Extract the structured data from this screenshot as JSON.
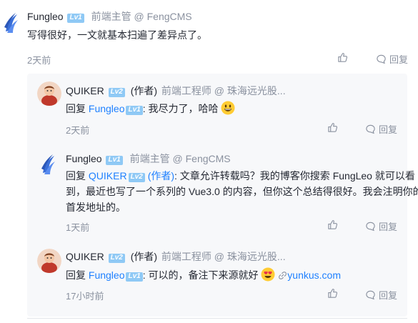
{
  "root_comment": {
    "user": "Fungleo",
    "level": "Lv1",
    "title": "前端主管 @ FengCMS",
    "content": "写得很好，一文就基本扫遍了差异点了。",
    "time": "2天前",
    "reply_label": "回复"
  },
  "replies": [
    {
      "user": "QUIKER",
      "level": "Lv2",
      "author_tag": "(作者)",
      "title": "前端工程师 @ 珠海远光股...",
      "reply_prefix": "回复",
      "reply_to": "Fungleo",
      "reply_to_level": "Lv1",
      "content": ": 我尽力了，哈哈",
      "time": "2天前",
      "reply_label": "回复"
    },
    {
      "user": "Fungleo",
      "level": "Lv1",
      "title": "前端主管 @ FengCMS",
      "reply_prefix": "回复",
      "reply_to": "QUIKER",
      "reply_to_level": "Lv2",
      "reply_to_tag": "(作者)",
      "content_line1": ": 文章允许转载吗？我的博客你搜索 FungLeo 就可以看",
      "content_line2": "到，最近也写了一个系列的 Vue3.0 的内容，但你这个总结得很好。我会注明你的",
      "content_line3": "首发地址的。",
      "time": "1天前",
      "reply_label": "回复"
    },
    {
      "user": "QUIKER",
      "level": "Lv2",
      "author_tag": "(作者)",
      "title": "前端工程师 @ 珠海远光股...",
      "reply_prefix": "回复",
      "reply_to": "Fungleo",
      "reply_to_level": "Lv1",
      "content": ": 可以的，备注下来源就好",
      "link_text": "yunkus.com",
      "time": "17小时前",
      "reply_label": "回复"
    }
  ],
  "icons": {
    "like": "thumbs-up-icon",
    "comment": "comment-bubble-icon",
    "link": "link-icon"
  },
  "colors": {
    "accent": "#1e80ff",
    "level_badge": "#8fc9f5",
    "muted": "#8a919f"
  }
}
